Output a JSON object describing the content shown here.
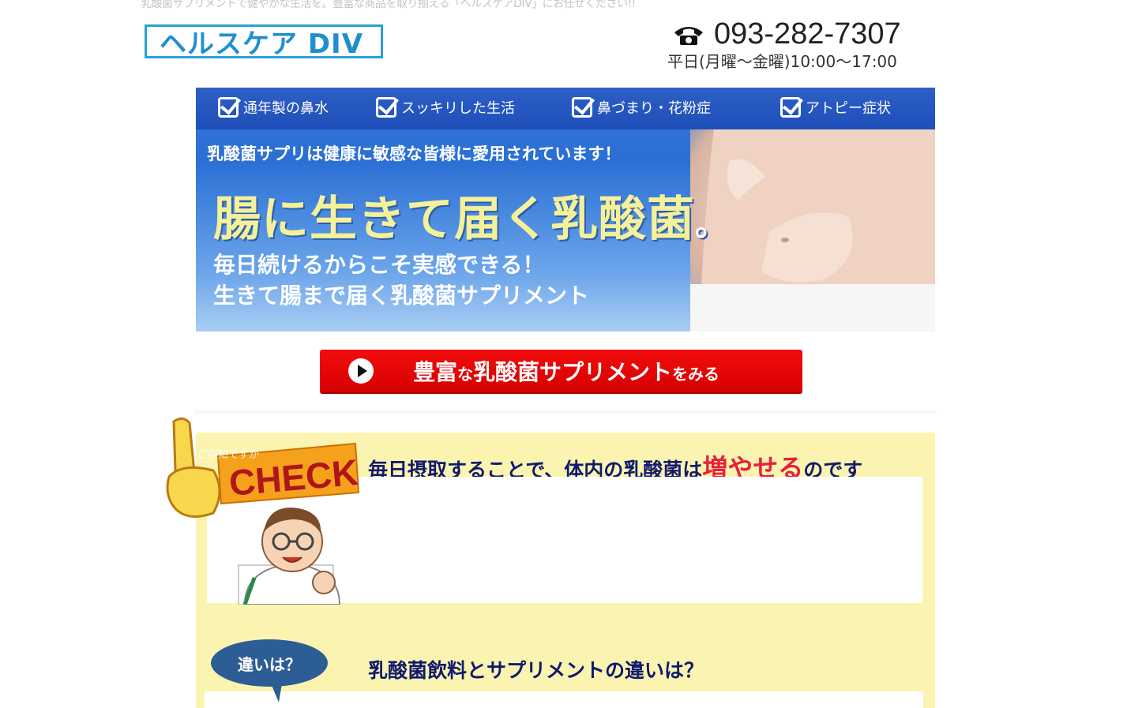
{
  "header": {
    "tagline": "乳酸菌サプリメントで健やかな生活を。豊富な商品を取り揃える「ヘルスケアDIV」にお任せください!!",
    "logo_text": "ヘルスケア DIV",
    "phone": "093-282-7307",
    "hours": "平日(月曜〜金曜)10:00〜17:00"
  },
  "hero": {
    "checks": [
      "通年製の鼻水",
      "スッキリした生活",
      "鼻づまり・花粉症",
      "アトピー症状"
    ],
    "subtitle": "乳酸菌サプリは健康に敏感な皆様に愛用されています！",
    "headline": "腸に生きて届く乳酸菌",
    "headline_mark": "。",
    "line2": "毎日続けるからこそ実感できる！",
    "line3": "生きて腸まで届く乳酸菌サプリメント"
  },
  "cta": {
    "label_main": "豊富な乳酸菌サプリメント",
    "label_small": "をみる",
    "label_mid": "な",
    "label_a": "豊富",
    "label_b": "乳酸菌サプリメント"
  },
  "check_section": {
    "badge_text": "CHECK",
    "badge_small": "ご存知ですか",
    "title_before": "毎日摂取することで、体内の乳酸菌は",
    "title_em": "増やせる",
    "title_after": "のです"
  },
  "diff_section": {
    "bubble": "違いは？",
    "title": "乳酸菌飲料とサプリメントの違いは？"
  },
  "colors": {
    "accent_blue": "#1f8fcf",
    "cta_red": "#e00000",
    "panel_yellow": "#fbf4b0",
    "title_navy": "#101a6e",
    "emphasis_red": "#e8203c"
  }
}
